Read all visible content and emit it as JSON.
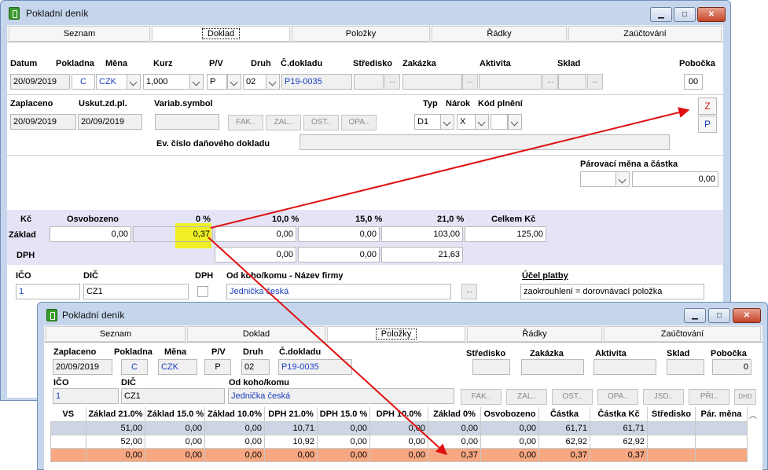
{
  "back_window": {
    "title": "Pokladní deník",
    "tabs": [
      "Seznam",
      "Doklad",
      "Položky",
      "Řádky",
      "Zaúčtování"
    ],
    "active_tab": "Doklad",
    "header": {
      "labels": {
        "datum": "Datum",
        "pokladna": "Pokladna",
        "mena": "Měna",
        "kurz": "Kurz",
        "pv": "P/V",
        "druh": "Druh",
        "cdokladu": "Č.dokladu",
        "stredisko": "Středisko",
        "zakazka": "Zakázka",
        "aktivita": "Aktivita",
        "sklad": "Sklad",
        "pobocka": "Pobočka"
      },
      "values": {
        "datum": "20/09/2019",
        "pokladna": "C",
        "mena": "CZK",
        "kurz": "1,000",
        "pv": "P",
        "druh": "02",
        "cdokladu": "P19-0035",
        "pobocka": "00"
      }
    },
    "row2": {
      "labels": {
        "zaplaceno": "Zaplaceno",
        "uskut": "Uskut.zd.pl.",
        "varsym": "Variab.symbol",
        "typ": "Typ",
        "narok": "Nárok",
        "kod": "Kód plnění",
        "ev": "Ev. číslo daňového dokladu"
      },
      "values": {
        "zaplaceno": "20/09/2019",
        "uskut": "20/09/2019",
        "typ": "D1",
        "narok": "X"
      },
      "buttons": [
        "FAK..",
        "ZAL..",
        "OST..",
        "OPA.."
      ],
      "side_buttons": [
        "Z",
        "P"
      ]
    },
    "parovaci": {
      "label": "Párovací měna a částka",
      "value": "0,00"
    },
    "vat": {
      "kc_label": "Kč",
      "headers": [
        "Osvobozeno",
        "0 %",
        "10,0 %",
        "15,0 %",
        "21,0 %",
        "Celkem Kč"
      ],
      "zaklad_label": "Základ",
      "dph_label": "DPH",
      "zaklad": [
        "0,00",
        "0,37",
        "0,00",
        "0,00",
        "103,00",
        "125,00"
      ],
      "dph": [
        "0,00",
        "0,00",
        "21,63"
      ]
    },
    "partner": {
      "labels": {
        "ico": "IČO",
        "dic": "DIČ",
        "dph": "DPH",
        "od": "Od koho/komu - Název firmy",
        "ucel": "Účel platby"
      },
      "values": {
        "ico": "1",
        "dic": "CZ1",
        "od": "Jednička česká",
        "ucel": "zaokrouhlení = dorovnávací položka"
      }
    }
  },
  "front_window": {
    "title": "Pokladní deník",
    "tabs": [
      "Seznam",
      "Doklad",
      "Položky",
      "Řádky",
      "Zaúčtování"
    ],
    "active_tab": "Položky",
    "header": {
      "labels": {
        "zaplaceno": "Zaplaceno",
        "pokladna": "Pokladna",
        "mena": "Měna",
        "pv": "P/V",
        "druh": "Druh",
        "cdokladu": "Č.dokladu",
        "stredisko": "Středisko",
        "zakazka": "Zakázka",
        "aktivita": "Aktivita",
        "sklad": "Sklad",
        "pobocka": "Pobočka",
        "ico": "IČO",
        "dic": "DIČ",
        "od": "Od koho/komu"
      },
      "values": {
        "zaplaceno": "20/09/2019",
        "pokladna": "C",
        "mena": "CZK",
        "pv": "P",
        "druh": "02",
        "cdokladu": "P19-0035",
        "pobocka": "0",
        "ico": "1",
        "dic": "CZ1",
        "od": "Jednička česká"
      }
    },
    "buttons": [
      "FAK..",
      "ZAL..",
      "OST..",
      "OPA..",
      "JSD..",
      "PŘI..",
      "DHD"
    ],
    "table": {
      "columns": [
        "VS",
        "Základ 21.0%",
        "Základ 15.0 %",
        "Základ 10.0%",
        "DPH 21.0%",
        "DPH 15.0 %",
        "DPH 10.0%",
        "Základ 0%",
        "Osvobozeno",
        "Částka",
        "Částka Kč",
        "Středisko",
        "Pár. měna"
      ],
      "rows": [
        [
          "",
          "51,00",
          "0,00",
          "0,00",
          "10,71",
          "0,00",
          "0,00",
          "0,00",
          "0,00",
          "61,71",
          "61,71",
          "",
          ""
        ],
        [
          "",
          "52,00",
          "0,00",
          "0,00",
          "10,92",
          "0,00",
          "0,00",
          "0,00",
          "0,00",
          "62,92",
          "62,92",
          "",
          ""
        ],
        [
          "",
          "0,00",
          "0,00",
          "0,00",
          "0,00",
          "0,00",
          "0,00",
          "0,37",
          "0,00",
          "0,37",
          "0,37",
          "",
          ""
        ]
      ]
    }
  },
  "colors": {
    "frame": "#c5d6ec",
    "highlight_row": "#f7a882",
    "selected_row": "#cdd5e4",
    "vat_band": "#e4e4f6",
    "arrow": "#e01010",
    "marker": "#f2f200",
    "link_text": "#1a3fc0"
  }
}
